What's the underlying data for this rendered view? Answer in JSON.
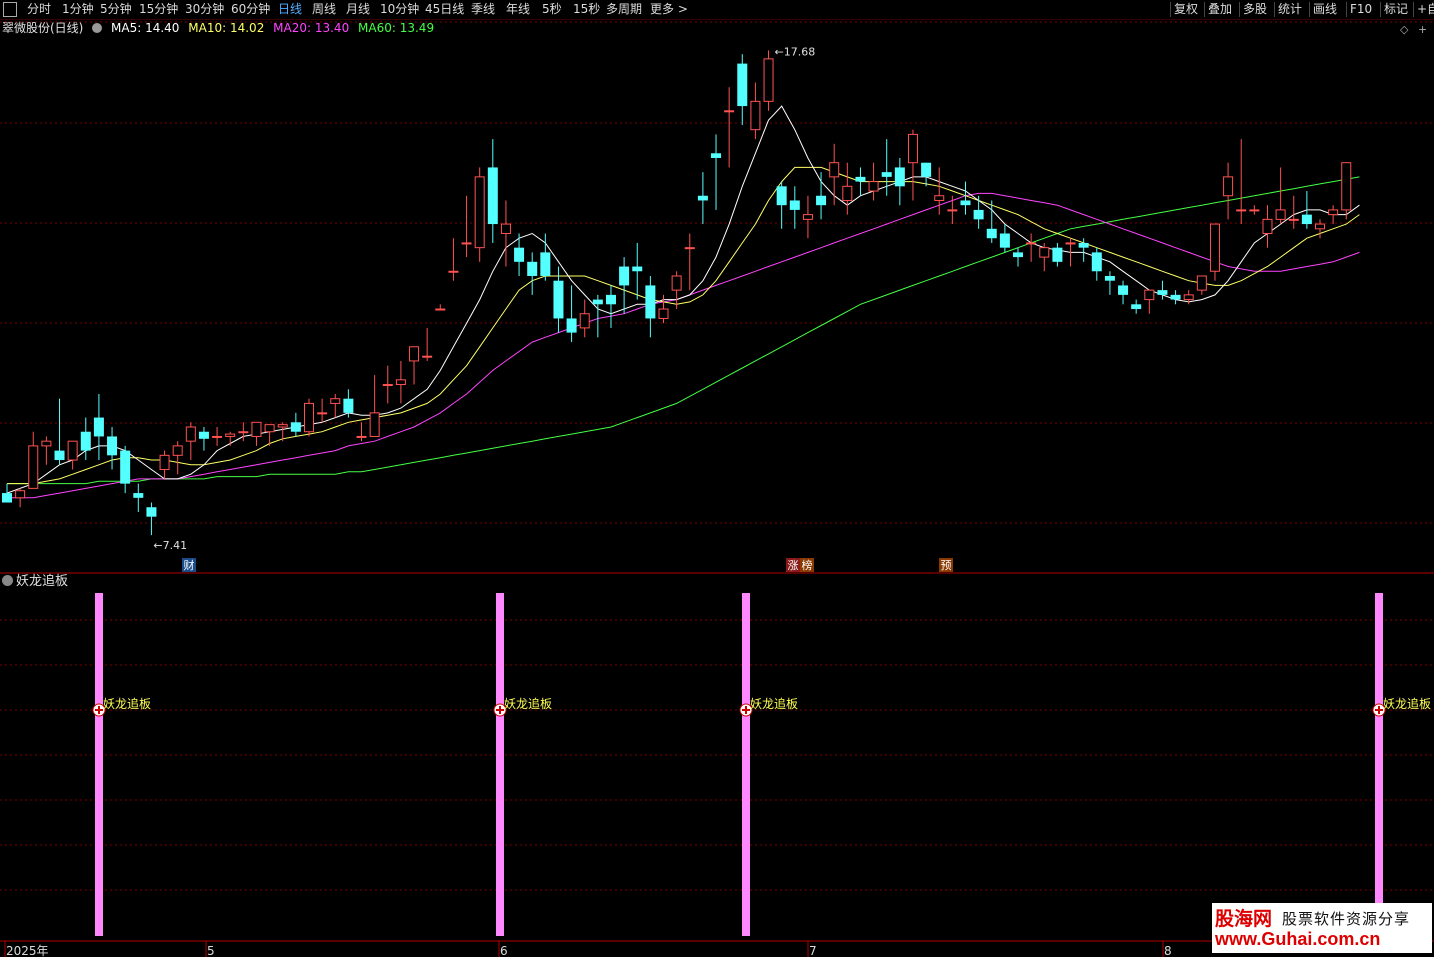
{
  "toolbar": {
    "left_items": [
      "分时",
      "1分钟",
      "5分钟",
      "15分钟",
      "30分钟",
      "60分钟",
      "日线",
      "周线",
      "月线",
      "10分钟",
      "45日线",
      "季线",
      "年线",
      "5秒",
      "15秒",
      "多周期",
      "更多 >"
    ],
    "active": "日线",
    "right_items": [
      "复权",
      "叠加",
      "多股",
      "统计",
      "画线",
      "F10",
      "标记",
      "+自"
    ]
  },
  "info": {
    "stock": "翠微股份(日线)",
    "ma5": "MA5: 14.40",
    "ma10": "MA10: 14.02",
    "ma20": "MA20: 13.40",
    "ma60": "MA60: 13.49",
    "colors": {
      "ma5": "#ffffff",
      "ma10": "#ffff66",
      "ma20": "#ff44ff",
      "ma60": "#44ff44",
      "up": "#ff5252",
      "down": "#54ffff"
    }
  },
  "chart_data": {
    "type": "candlestick",
    "high_label": "17.68",
    "low_label": "7.41",
    "event_tags": [
      "财",
      "涨",
      "榜",
      "预"
    ],
    "x_axis_labels": [
      "2025年",
      "5",
      "6",
      "7",
      "8"
    ],
    "ohlc": [
      [
        8.3,
        8.5,
        8.1,
        8.1
      ],
      [
        8.2,
        8.4,
        8.0,
        8.35
      ],
      [
        8.4,
        9.6,
        8.4,
        9.3
      ],
      [
        9.3,
        9.5,
        8.9,
        9.4
      ],
      [
        9.2,
        10.3,
        8.9,
        9.0
      ],
      [
        9.0,
        9.4,
        8.8,
        9.4
      ],
      [
        9.6,
        9.9,
        9.0,
        9.2
      ],
      [
        9.9,
        10.4,
        9.0,
        9.5
      ],
      [
        9.5,
        9.7,
        8.8,
        9.1
      ],
      [
        9.2,
        9.3,
        8.3,
        8.5
      ],
      [
        8.3,
        8.5,
        7.9,
        8.2
      ],
      [
        8.0,
        8.1,
        7.41,
        7.8
      ],
      [
        8.8,
        9.2,
        8.6,
        9.1
      ],
      [
        9.1,
        9.4,
        8.7,
        9.3
      ],
      [
        9.4,
        9.8,
        9.0,
        9.7
      ],
      [
        9.6,
        9.7,
        9.2,
        9.45
      ],
      [
        9.5,
        9.7,
        9.3,
        9.5
      ],
      [
        9.5,
        9.6,
        9.3,
        9.55
      ],
      [
        9.6,
        9.8,
        9.4,
        9.6
      ],
      [
        9.5,
        9.7,
        9.3,
        9.8
      ],
      [
        9.6,
        9.7,
        9.3,
        9.75
      ],
      [
        9.7,
        9.8,
        9.4,
        9.75
      ],
      [
        9.8,
        10.0,
        9.5,
        9.6
      ],
      [
        9.6,
        10.3,
        9.5,
        10.2
      ],
      [
        10.0,
        10.3,
        9.8,
        10.0
      ],
      [
        10.2,
        10.4,
        9.9,
        10.3
      ],
      [
        10.3,
        10.5,
        9.9,
        10.0
      ],
      [
        9.5,
        9.8,
        9.4,
        9.5
      ],
      [
        9.5,
        10.8,
        9.5,
        10.0
      ],
      [
        10.6,
        11.0,
        10.2,
        10.6
      ],
      [
        10.6,
        11.1,
        10.2,
        10.7
      ],
      [
        11.1,
        11.3,
        10.6,
        11.4
      ],
      [
        11.2,
        11.8,
        11.1,
        11.2
      ],
      [
        12.2,
        12.3,
        12.2,
        12.2
      ],
      [
        13.0,
        13.7,
        12.8,
        13.0
      ],
      [
        13.6,
        14.6,
        13.3,
        13.6
      ],
      [
        13.5,
        15.2,
        13.2,
        15.0
      ],
      [
        15.2,
        15.8,
        13.6,
        14.0
      ],
      [
        13.8,
        14.5,
        13.1,
        14.0
      ],
      [
        13.5,
        13.8,
        12.9,
        13.2
      ],
      [
        13.2,
        13.4,
        12.5,
        12.9
      ],
      [
        13.4,
        13.8,
        12.8,
        12.9
      ],
      [
        12.8,
        13.1,
        11.7,
        12.0
      ],
      [
        12.0,
        12.7,
        11.5,
        11.7
      ],
      [
        11.8,
        12.4,
        11.6,
        12.1
      ],
      [
        12.4,
        12.5,
        11.6,
        12.3
      ],
      [
        12.5,
        12.7,
        11.8,
        12.3
      ],
      [
        13.1,
        13.3,
        12.1,
        12.7
      ],
      [
        13.1,
        13.6,
        12.4,
        13.0
      ],
      [
        12.7,
        12.9,
        11.6,
        12.0
      ],
      [
        12.0,
        12.5,
        11.9,
        12.2
      ],
      [
        12.6,
        13.0,
        12.2,
        12.9
      ],
      [
        13.5,
        13.8,
        12.6,
        13.5
      ],
      [
        14.6,
        15.1,
        14.0,
        14.5
      ],
      [
        15.5,
        15.9,
        14.3,
        15.4
      ],
      [
        16.4,
        16.9,
        15.2,
        16.4
      ],
      [
        17.4,
        17.6,
        16.1,
        16.5
      ],
      [
        16.0,
        17.0,
        15.8,
        16.6
      ],
      [
        16.6,
        17.68,
        16.4,
        17.5
      ],
      [
        14.8,
        14.9,
        13.9,
        14.4
      ],
      [
        14.5,
        14.8,
        13.9,
        14.3
      ],
      [
        14.1,
        14.6,
        13.7,
        14.2
      ],
      [
        14.6,
        15.1,
        14.1,
        14.4
      ],
      [
        15.0,
        15.7,
        14.4,
        15.3
      ],
      [
        14.5,
        15.3,
        14.2,
        14.8
      ],
      [
        15.0,
        15.2,
        14.6,
        14.9
      ],
      [
        14.7,
        15.3,
        14.5,
        14.9
      ],
      [
        15.1,
        15.8,
        14.6,
        15.0
      ],
      [
        15.2,
        15.4,
        14.4,
        14.8
      ],
      [
        15.3,
        16.0,
        14.5,
        15.9
      ],
      [
        15.3,
        15.3,
        14.8,
        15.0
      ],
      [
        14.5,
        15.2,
        14.2,
        14.6
      ],
      [
        14.3,
        14.6,
        14.0,
        14.3
      ],
      [
        14.5,
        14.9,
        14.2,
        14.4
      ],
      [
        14.3,
        14.6,
        13.9,
        14.1
      ],
      [
        13.9,
        14.5,
        13.6,
        13.7
      ],
      [
        13.8,
        14.0,
        13.4,
        13.5
      ],
      [
        13.4,
        13.5,
        13.1,
        13.3
      ],
      [
        13.6,
        13.8,
        13.2,
        13.6
      ],
      [
        13.3,
        13.6,
        13.0,
        13.5
      ],
      [
        13.5,
        13.6,
        13.1,
        13.2
      ],
      [
        13.6,
        13.7,
        13.1,
        13.6
      ],
      [
        13.6,
        13.7,
        13.2,
        13.5
      ],
      [
        13.4,
        13.5,
        12.8,
        13.0
      ],
      [
        12.9,
        13.0,
        12.5,
        12.8
      ],
      [
        12.7,
        12.8,
        12.3,
        12.5
      ],
      [
        12.3,
        12.4,
        12.1,
        12.2
      ],
      [
        12.4,
        12.6,
        12.1,
        12.6
      ],
      [
        12.6,
        12.8,
        12.4,
        12.5
      ],
      [
        12.5,
        12.6,
        12.3,
        12.4
      ],
      [
        12.4,
        12.6,
        12.3,
        12.5
      ],
      [
        12.6,
        12.9,
        12.5,
        12.9
      ],
      [
        13.0,
        14.0,
        12.8,
        14.0
      ],
      [
        14.6,
        15.3,
        14.1,
        15.0
      ],
      [
        14.3,
        15.8,
        14.0,
        14.3
      ],
      [
        14.3,
        14.4,
        14.2,
        14.3
      ],
      [
        13.8,
        14.4,
        13.5,
        14.1
      ],
      [
        14.1,
        15.2,
        14.0,
        14.3
      ],
      [
        14.1,
        14.6,
        13.9,
        14.1
      ],
      [
        14.2,
        14.7,
        13.9,
        14.0
      ],
      [
        13.9,
        14.1,
        13.7,
        14.0
      ],
      [
        14.2,
        14.4,
        14.0,
        14.3
      ],
      [
        14.3,
        15.3,
        14.1,
        15.3
      ]
    ],
    "ma5": [
      8.3,
      8.4,
      8.5,
      8.7,
      8.9,
      9.0,
      9.2,
      9.3,
      9.3,
      9.2,
      9.0,
      8.8,
      8.6,
      8.6,
      8.7,
      8.9,
      9.2,
      9.35,
      9.5,
      9.55,
      9.6,
      9.65,
      9.7,
      9.75,
      9.8,
      9.9,
      10.0,
      9.95,
      9.95,
      10.0,
      10.1,
      10.3,
      10.5,
      10.9,
      11.4,
      11.9,
      12.4,
      13.0,
      13.5,
      13.7,
      13.8,
      13.6,
      13.2,
      12.8,
      12.5,
      12.2,
      12.1,
      12.2,
      12.3,
      12.3,
      12.4,
      12.4,
      12.5,
      12.8,
      13.3,
      14.0,
      14.8,
      15.5,
      16.2,
      16.5,
      16.0,
      15.4,
      14.9,
      14.6,
      14.4,
      14.6,
      14.7,
      14.8,
      14.9,
      15.0,
      15.0,
      14.9,
      14.8,
      14.7,
      14.5,
      14.3,
      14.0,
      13.8,
      13.6,
      13.5,
      13.45,
      13.4,
      13.4,
      13.3,
      13.2,
      13.0,
      12.8,
      12.6,
      12.5,
      12.4,
      12.35,
      12.4,
      12.5,
      12.8,
      13.2,
      13.6,
      13.8,
      14.0,
      14.2,
      14.3,
      14.3,
      14.2,
      14.2,
      14.4
    ],
    "ma10": [
      8.5,
      8.5,
      8.5,
      8.55,
      8.6,
      8.7,
      8.8,
      8.9,
      9.0,
      9.05,
      9.05,
      9.0,
      9.0,
      8.95,
      8.9,
      8.9,
      8.95,
      9.0,
      9.1,
      9.2,
      9.35,
      9.45,
      9.5,
      9.55,
      9.6,
      9.7,
      9.8,
      9.85,
      9.9,
      9.95,
      10.0,
      10.1,
      10.2,
      10.4,
      10.7,
      11.0,
      11.4,
      11.8,
      12.2,
      12.6,
      12.8,
      12.9,
      12.9,
      12.9,
      12.9,
      12.8,
      12.7,
      12.6,
      12.5,
      12.4,
      12.35,
      12.3,
      12.35,
      12.5,
      12.8,
      13.2,
      13.6,
      14.0,
      14.5,
      14.9,
      15.2,
      15.2,
      15.2,
      15.1,
      15.0,
      14.9,
      14.9,
      14.9,
      14.9,
      14.9,
      14.85,
      14.8,
      14.7,
      14.6,
      14.5,
      14.4,
      14.3,
      14.2,
      14.05,
      13.9,
      13.8,
      13.7,
      13.6,
      13.5,
      13.4,
      13.3,
      13.2,
      13.1,
      13.0,
      12.9,
      12.8,
      12.75,
      12.7,
      12.7,
      12.8,
      12.95,
      13.1,
      13.3,
      13.5,
      13.7,
      13.8,
      13.9,
      14.0,
      14.2
    ],
    "ma20": [
      8.2,
      8.2,
      8.2,
      8.25,
      8.3,
      8.35,
      8.4,
      8.45,
      8.5,
      8.55,
      8.6,
      8.6,
      8.6,
      8.6,
      8.65,
      8.7,
      8.75,
      8.8,
      8.85,
      8.9,
      8.95,
      9.0,
      9.05,
      9.1,
      9.15,
      9.2,
      9.3,
      9.35,
      9.4,
      9.5,
      9.6,
      9.7,
      9.85,
      10.0,
      10.2,
      10.4,
      10.65,
      10.9,
      11.1,
      11.3,
      11.5,
      11.6,
      11.7,
      11.8,
      11.9,
      12.0,
      12.05,
      12.1,
      12.2,
      12.3,
      12.35,
      12.4,
      12.5,
      12.6,
      12.7,
      12.8,
      12.9,
      13.0,
      13.1,
      13.2,
      13.3,
      13.4,
      13.5,
      13.6,
      13.7,
      13.8,
      13.9,
      14.0,
      14.1,
      14.2,
      14.3,
      14.4,
      14.5,
      14.6,
      14.65,
      14.65,
      14.6,
      14.55,
      14.5,
      14.45,
      14.4,
      14.3,
      14.2,
      14.1,
      14.0,
      13.9,
      13.8,
      13.7,
      13.6,
      13.5,
      13.4,
      13.3,
      13.2,
      13.1,
      13.05,
      13.0,
      13.0,
      13.0,
      13.05,
      13.1,
      13.15,
      13.2,
      13.3,
      13.4
    ],
    "ma60": [
      8.5,
      8.5,
      8.5,
      8.5,
      8.5,
      8.5,
      8.5,
      8.55,
      8.55,
      8.55,
      8.55,
      8.6,
      8.6,
      8.6,
      8.6,
      8.6,
      8.65,
      8.65,
      8.65,
      8.65,
      8.7,
      8.7,
      8.7,
      8.7,
      8.7,
      8.7,
      8.75,
      8.75,
      8.8,
      8.85,
      8.9,
      8.95,
      9.0,
      9.05,
      9.1,
      9.15,
      9.2,
      9.25,
      9.3,
      9.35,
      9.4,
      9.45,
      9.5,
      9.55,
      9.6,
      9.65,
      9.7,
      9.8,
      9.9,
      10.0,
      10.1,
      10.2,
      10.35,
      10.5,
      10.65,
      10.8,
      10.95,
      11.1,
      11.25,
      11.4,
      11.55,
      11.7,
      11.85,
      12.0,
      12.15,
      12.3,
      12.4,
      12.5,
      12.6,
      12.7,
      12.8,
      12.9,
      13.0,
      13.1,
      13.2,
      13.3,
      13.4,
      13.5,
      13.6,
      13.7,
      13.8,
      13.9,
      13.95,
      14.0,
      14.05,
      14.1,
      14.15,
      14.2,
      14.25,
      14.3,
      14.35,
      14.4,
      14.45,
      14.5,
      14.55,
      14.6,
      14.65,
      14.7,
      14.75,
      14.8,
      14.85,
      14.9,
      14.95,
      15.0
    ]
  },
  "indicator": {
    "title": "妖龙追板",
    "signal_label": "妖龙追板",
    "signal_color": "#ff88ff",
    "signal_count": 4
  },
  "watermark": {
    "line1": "股海网",
    "line1b": "股票软件资源分享",
    "line2": "www.Guhai.com.cn"
  }
}
